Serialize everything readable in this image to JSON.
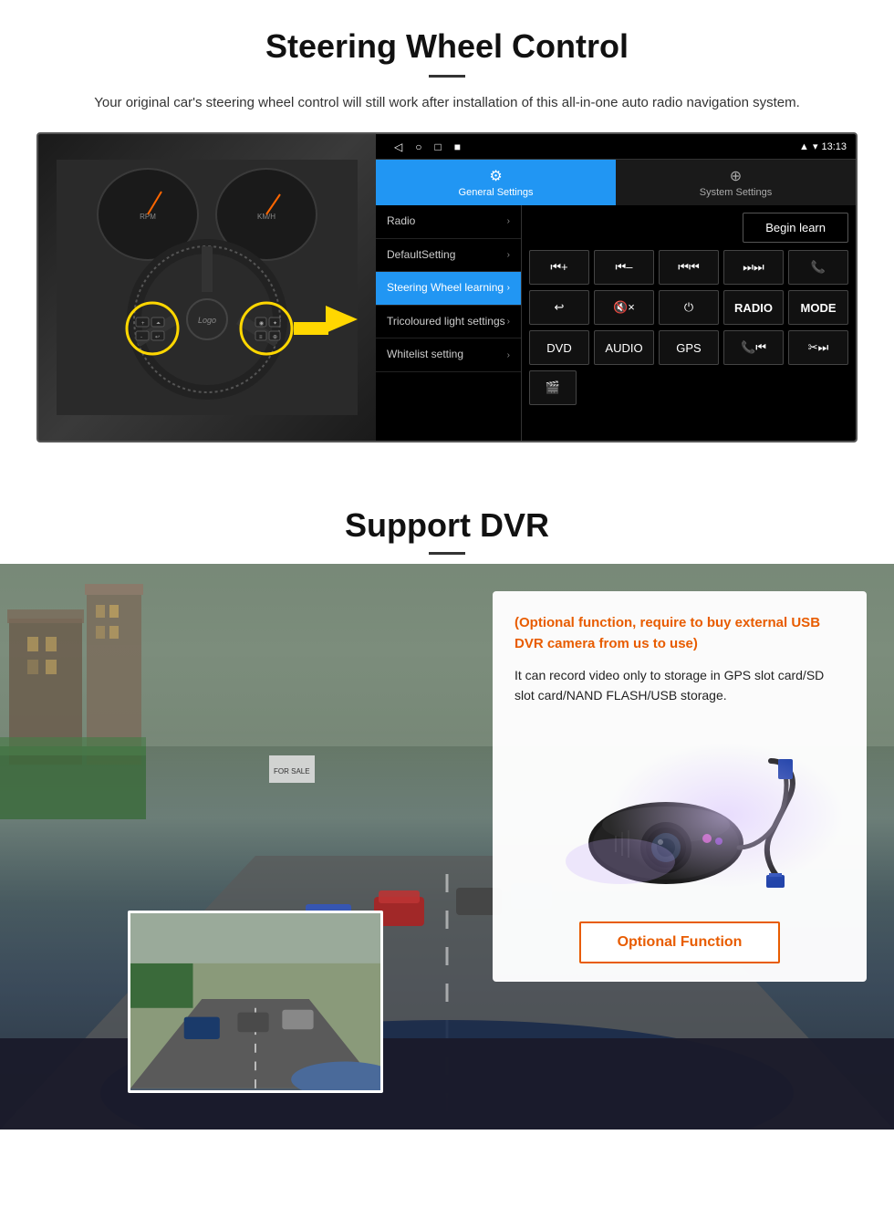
{
  "steering": {
    "title": "Steering Wheel Control",
    "subtitle": "Your original car's steering wheel control will still work after installation of this all-in-one auto radio navigation system.",
    "statusbar": {
      "time": "13:13",
      "nav_icons": [
        "◁",
        "○",
        "□",
        "■"
      ]
    },
    "tabs": [
      {
        "id": "general",
        "icon": "⚙",
        "label": "General Settings",
        "active": true
      },
      {
        "id": "system",
        "icon": "⊕",
        "label": "System Settings",
        "active": false
      }
    ],
    "menu_items": [
      {
        "label": "Radio",
        "active": false
      },
      {
        "label": "DefaultSetting",
        "active": false
      },
      {
        "label": "Steering Wheel learning",
        "active": true
      },
      {
        "label": "Tricoloured light settings",
        "active": false
      },
      {
        "label": "Whitelist setting",
        "active": false
      }
    ],
    "begin_learn": "Begin learn",
    "control_buttons": [
      [
        "⏮+",
        "⏮-",
        "⏭⏭",
        "⏭⏭⏭",
        "📞"
      ],
      [
        "↩",
        "🔇×",
        "⏻",
        "RADIO",
        "MODE"
      ],
      [
        "DVD",
        "AUDIO",
        "GPS",
        "📞⏭",
        "✂⏭"
      ],
      [
        "🎬"
      ]
    ]
  },
  "dvr": {
    "title": "Support DVR",
    "optional_text": "(Optional function, require to buy external USB DVR camera from us to use)",
    "description": "It can record video only to storage in GPS slot card/SD slot card/NAND FLASH/USB storage.",
    "optional_button": "Optional Function"
  }
}
